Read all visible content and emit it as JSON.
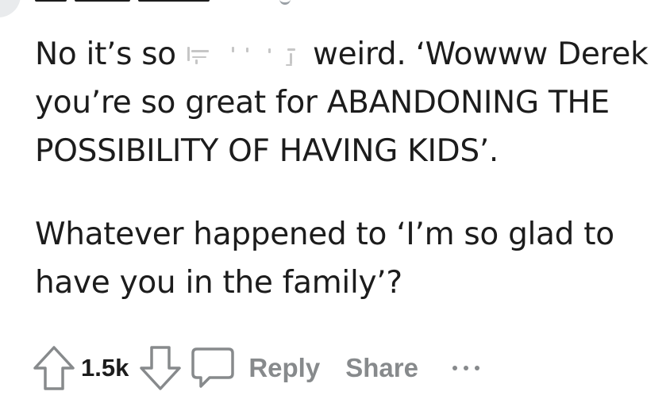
{
  "comment": {
    "paragraph_1": {
      "before_censor": "No it’s so ",
      "after_censor": " weird. ‘Wowww Derek you’re so great for ABANDONING THE POSSIBILITY OF HAVING KIDS’."
    },
    "paragraph_2": "Whatever happened to ‘I’m so glad to have you in the family’?"
  },
  "actions": {
    "upvote_icon": "arrow-up-outline-icon",
    "vote_count": "1.5k",
    "downvote_icon": "arrow-down-outline-icon",
    "reply_icon": "speech-bubble-icon",
    "reply_label": "Reply",
    "share_label": "Share",
    "more_icon": "ellipsis-icon"
  },
  "colors": {
    "text": "#1c1c1c",
    "muted": "#878a8c",
    "background": "#ffffff"
  }
}
